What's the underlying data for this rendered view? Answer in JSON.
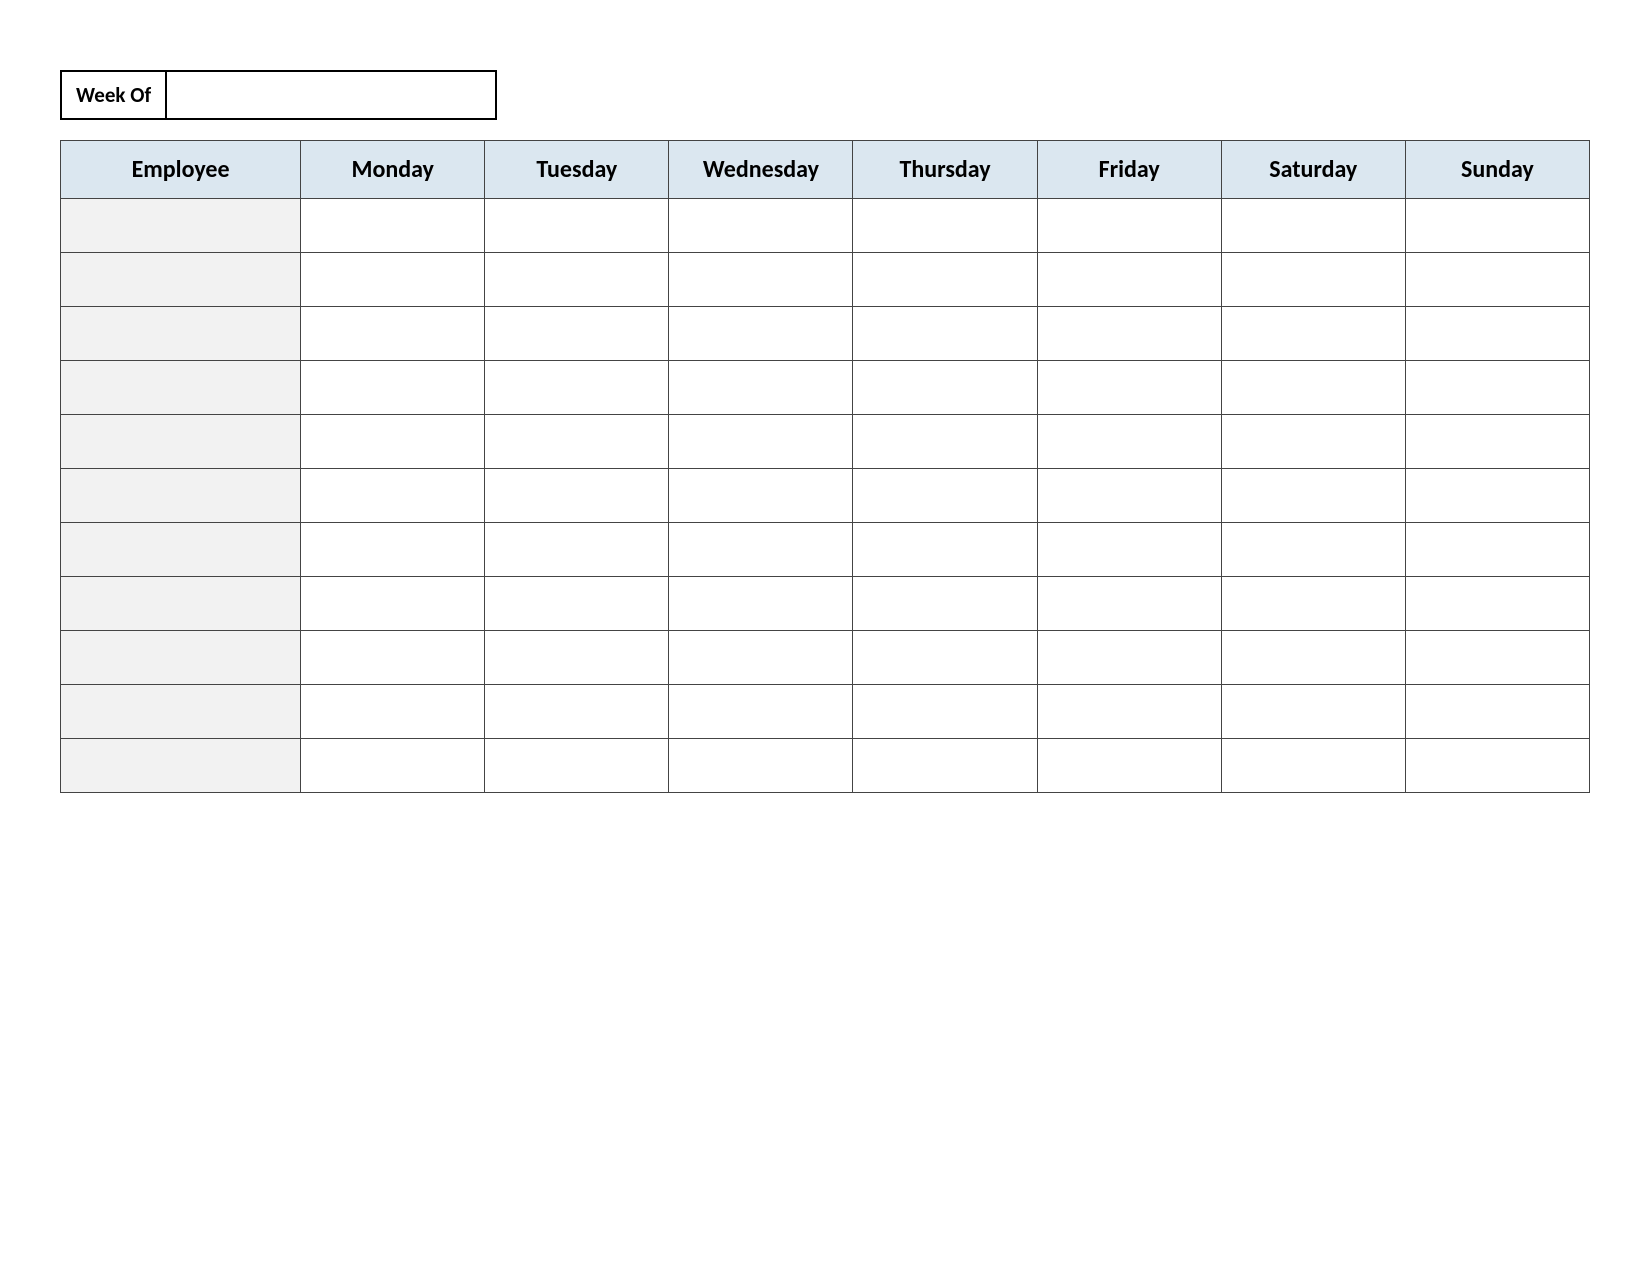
{
  "colors": {
    "header_bg": "#dbe7f0",
    "employee_col_bg": "#f2f2f2"
  },
  "weekof": {
    "label": "Week Of",
    "value": ""
  },
  "table": {
    "headers": [
      "Employee",
      "Monday",
      "Tuesday",
      "Wednesday",
      "Thursday",
      "Friday",
      "Saturday",
      "Sunday"
    ],
    "rows": [
      {
        "employee": "",
        "cells": [
          "",
          "",
          "",
          "",
          "",
          "",
          ""
        ]
      },
      {
        "employee": "",
        "cells": [
          "",
          "",
          "",
          "",
          "",
          "",
          ""
        ]
      },
      {
        "employee": "",
        "cells": [
          "",
          "",
          "",
          "",
          "",
          "",
          ""
        ]
      },
      {
        "employee": "",
        "cells": [
          "",
          "",
          "",
          "",
          "",
          "",
          ""
        ]
      },
      {
        "employee": "",
        "cells": [
          "",
          "",
          "",
          "",
          "",
          "",
          ""
        ]
      },
      {
        "employee": "",
        "cells": [
          "",
          "",
          "",
          "",
          "",
          "",
          ""
        ]
      },
      {
        "employee": "",
        "cells": [
          "",
          "",
          "",
          "",
          "",
          "",
          ""
        ]
      },
      {
        "employee": "",
        "cells": [
          "",
          "",
          "",
          "",
          "",
          "",
          ""
        ]
      },
      {
        "employee": "",
        "cells": [
          "",
          "",
          "",
          "",
          "",
          "",
          ""
        ]
      },
      {
        "employee": "",
        "cells": [
          "",
          "",
          "",
          "",
          "",
          "",
          ""
        ]
      },
      {
        "employee": "",
        "cells": [
          "",
          "",
          "",
          "",
          "",
          "",
          ""
        ]
      }
    ]
  }
}
